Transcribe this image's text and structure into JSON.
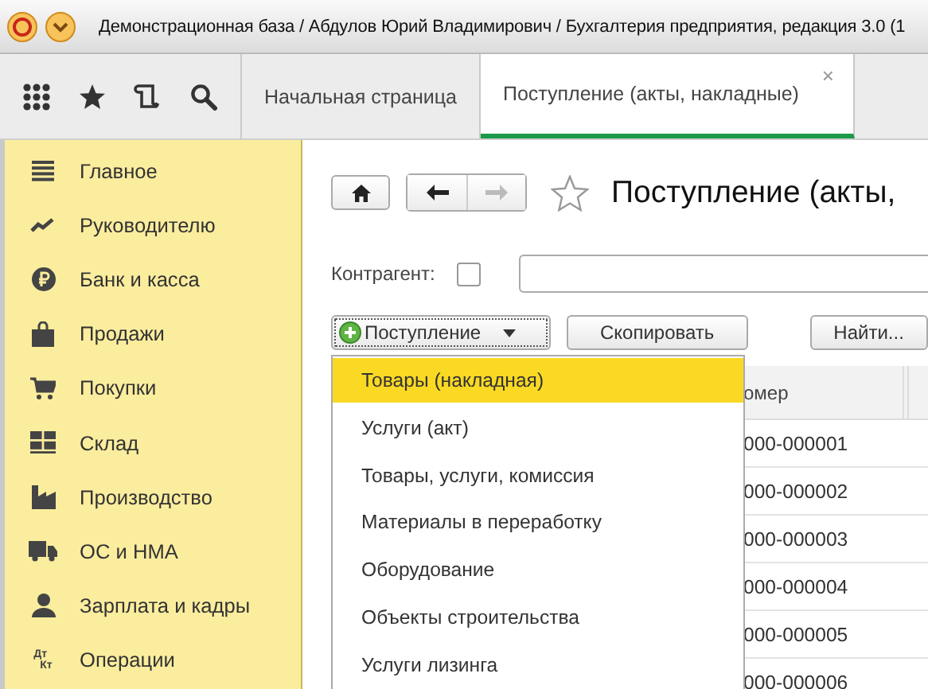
{
  "window": {
    "title": "Демонстрационная база / Абдулов Юрий Владимирович / Бухгалтерия предприятия, редакция 3.0  (1"
  },
  "tabs": [
    {
      "label": "Начальная страница",
      "selected": false
    },
    {
      "label": "Поступление (акты, накладные)",
      "selected": true,
      "close": "×"
    }
  ],
  "sidebar": {
    "items": [
      {
        "label": "Главное"
      },
      {
        "label": "Руководителю"
      },
      {
        "label": "Банк и касса"
      },
      {
        "label": "Продажи"
      },
      {
        "label": "Покупки"
      },
      {
        "label": "Склад"
      },
      {
        "label": "Производство"
      },
      {
        "label": "ОС и НМА"
      },
      {
        "label": "Зарплата и кадры"
      },
      {
        "label": "Операции",
        "icon_text": [
          "Дт",
          "Кт"
        ]
      }
    ]
  },
  "form": {
    "title": "Поступление (акты,",
    "favorite": false,
    "filter": {
      "label": "Контрагент:",
      "checked": false
    },
    "buttons": [
      {
        "label": "Поступление",
        "kind": "dropdown"
      },
      {
        "label": "Скопировать",
        "kind": "plain"
      },
      {
        "label": "Найти...",
        "kind": "plain"
      }
    ],
    "menu": [
      {
        "label": "Товары (накладная)",
        "selected": true
      },
      {
        "label": "Услуги (акт)",
        "selected": false
      },
      {
        "label": "Товары, услуги, комиссия",
        "selected": false
      },
      {
        "label": "Материалы в переработку",
        "selected": false
      },
      {
        "label": "Оборудование",
        "selected": false
      },
      {
        "label": "Объекты строительства",
        "selected": false
      },
      {
        "label": "Услуги лизинга",
        "selected": false
      }
    ],
    "table": {
      "columns": [
        "омер"
      ],
      "rows": [
        [
          "000-000001"
        ],
        [
          "000-000002"
        ],
        [
          "000-000003"
        ],
        [
          "000-000004"
        ],
        [
          "000-000005"
        ],
        [
          "000-000006"
        ]
      ]
    }
  }
}
